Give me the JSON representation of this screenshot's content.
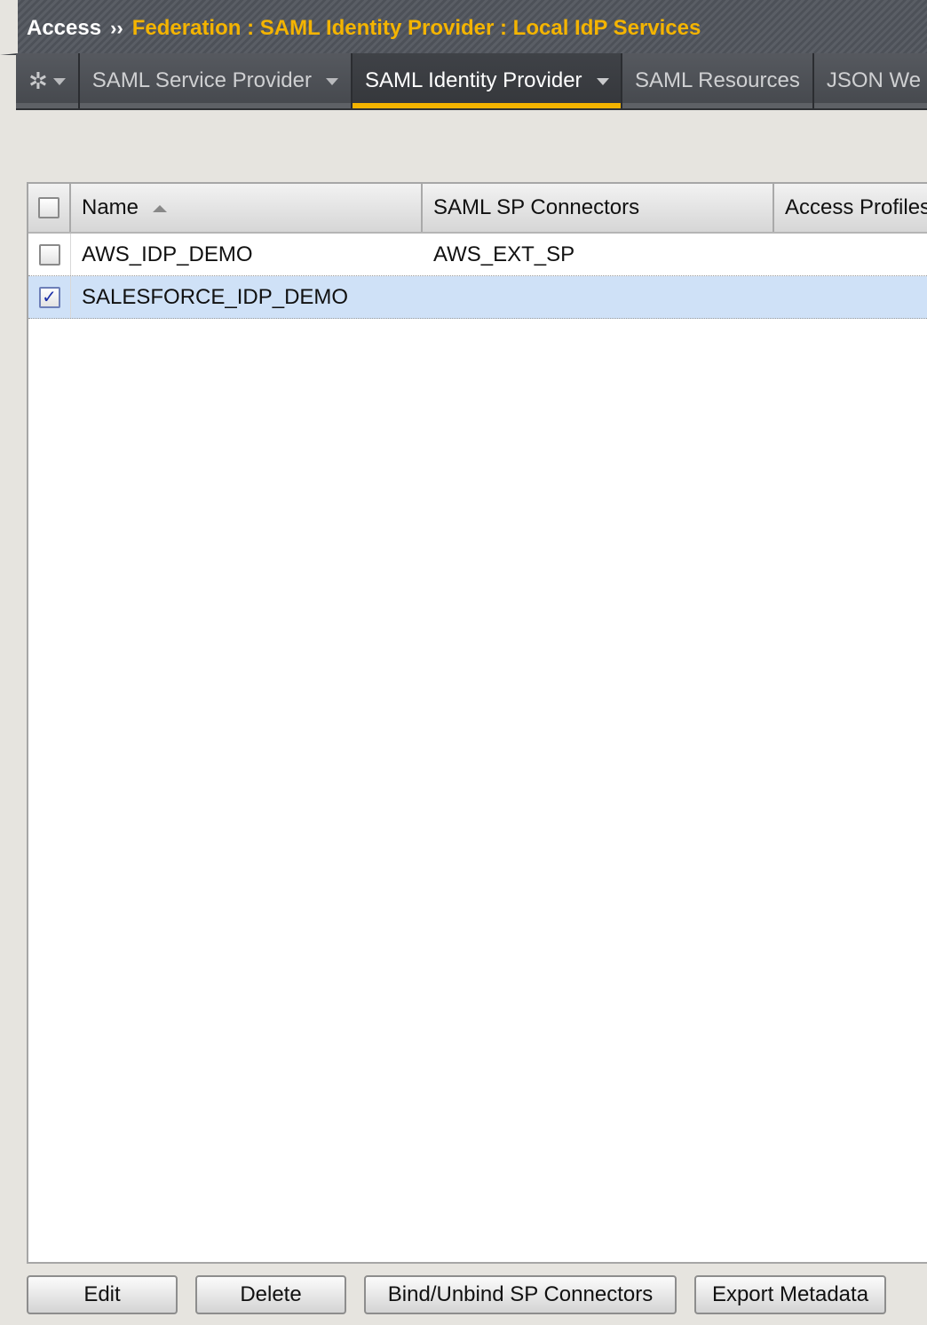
{
  "breadcrumb": {
    "root": "Access",
    "separator": "››",
    "path": "Federation : SAML Identity Provider : Local IdP Services"
  },
  "tabs": {
    "gear_icon": "gear-icon",
    "items": [
      {
        "label": "SAML Service Provider",
        "has_dropdown": true,
        "active": false
      },
      {
        "label": "SAML Identity Provider",
        "has_dropdown": true,
        "active": true
      },
      {
        "label": "SAML Resources",
        "has_dropdown": false,
        "active": false
      },
      {
        "label": "JSON We",
        "has_dropdown": false,
        "active": false
      }
    ]
  },
  "table": {
    "columns": [
      "Name",
      "SAML SP Connectors",
      "Access Profiles"
    ],
    "sort": {
      "column": "Name",
      "direction": "ascending"
    },
    "header_checkbox_checked": false,
    "rows": [
      {
        "checked": false,
        "name": "AWS_IDP_DEMO",
        "connectors": "AWS_EXT_SP",
        "profiles": ""
      },
      {
        "checked": true,
        "name": "SALESFORCE_IDP_DEMO",
        "connectors": "",
        "profiles": ""
      }
    ]
  },
  "actions": {
    "edit": "Edit",
    "delete": "Delete",
    "bind": "Bind/Unbind SP Connectors",
    "export": "Export Metadata"
  },
  "colors": {
    "accent": "#f4b400",
    "header_bg": "#51555d",
    "selected_row": "#cfe1f7",
    "checkmark": "#1b2fa8"
  }
}
